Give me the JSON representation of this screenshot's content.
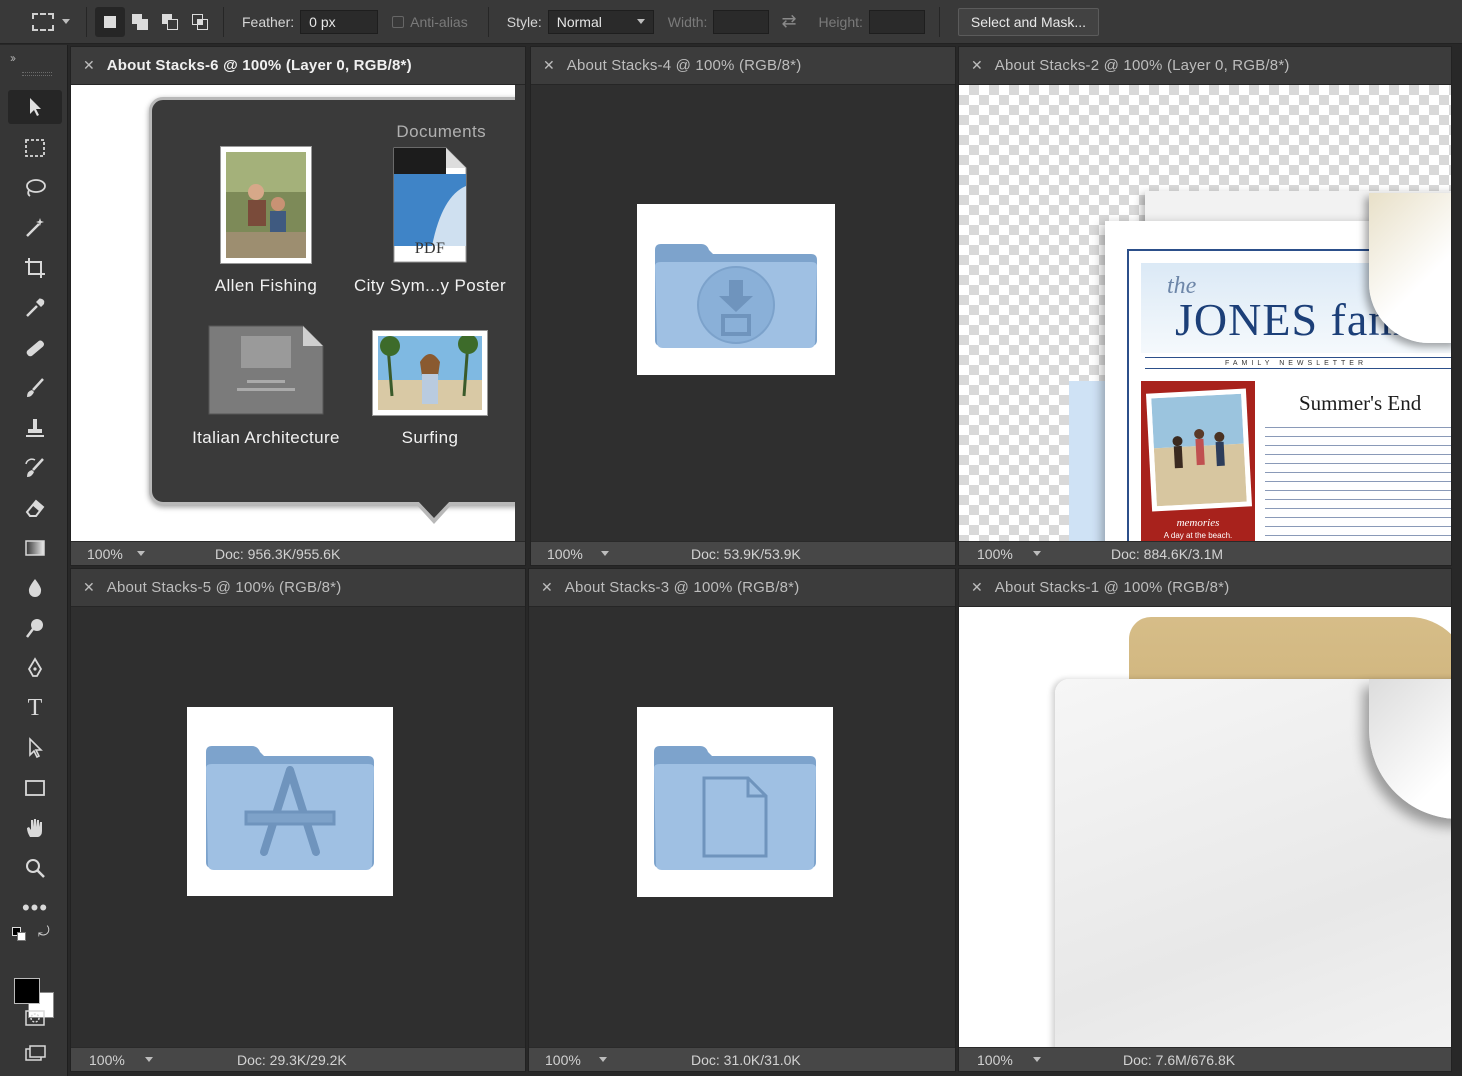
{
  "options_bar": {
    "feather_label": "Feather:",
    "feather_value": "0 px",
    "antialias_label": "Anti-alias",
    "style_label": "Style:",
    "style_value": "Normal",
    "width_label": "Width:",
    "height_label": "Height:",
    "select_mask_label": "Select and Mask..."
  },
  "toolbar": {
    "tools": [
      "move-tool",
      "rectangular-marquee-tool",
      "lasso-tool",
      "magic-wand-tool",
      "crop-tool",
      "eyedropper-tool",
      "healing-brush-tool",
      "brush-tool",
      "clone-stamp-tool",
      "history-brush-tool",
      "eraser-tool",
      "gradient-tool",
      "blur-tool",
      "dodge-tool",
      "pen-tool",
      "type-tool",
      "path-selection-tool",
      "rectangle-tool",
      "hand-tool",
      "zoom-tool",
      "more-tools"
    ],
    "foreground_color": "#000000",
    "background_color": "#ffffff"
  },
  "documents": [
    {
      "title": "About Stacks-6 @ 100% (Layer 0, RGB/8*)",
      "zoom": "100%",
      "doc_size": "Doc: 956.3K/955.6K",
      "stack": {
        "header": "Documents",
        "items": [
          {
            "label": "Allen Fishing"
          },
          {
            "label": "City Sym...y Poster",
            "badge": "PDF"
          },
          {
            "label": "Italian Architecture"
          },
          {
            "label": "Surfing"
          }
        ]
      }
    },
    {
      "title": "About Stacks-4 @ 100% (RGB/8*)",
      "zoom": "100%",
      "doc_size": "Doc: 53.9K/53.9K"
    },
    {
      "title": "About Stacks-2 @ 100% (Layer 0, RGB/8*)",
      "zoom": "100%",
      "doc_size": "Doc: 884.6K/3.1M",
      "newsletter": {
        "the": "the",
        "name": "JONES fam",
        "subtitle": "FAMILY NEWSLETTER",
        "headline": "Summer's End",
        "caption1": "memories",
        "caption2": "A day at the beach."
      }
    },
    {
      "title": "About Stacks-5 @ 100% (RGB/8*)",
      "zoom": "100%",
      "doc_size": "Doc: 29.3K/29.2K"
    },
    {
      "title": "About Stacks-3 @ 100% (RGB/8*)",
      "zoom": "100%",
      "doc_size": "Doc: 31.0K/31.0K"
    },
    {
      "title": "About Stacks-1 @ 100% (RGB/8*)",
      "zoom": "100%",
      "doc_size": "Doc: 7.6M/676.8K"
    }
  ]
}
